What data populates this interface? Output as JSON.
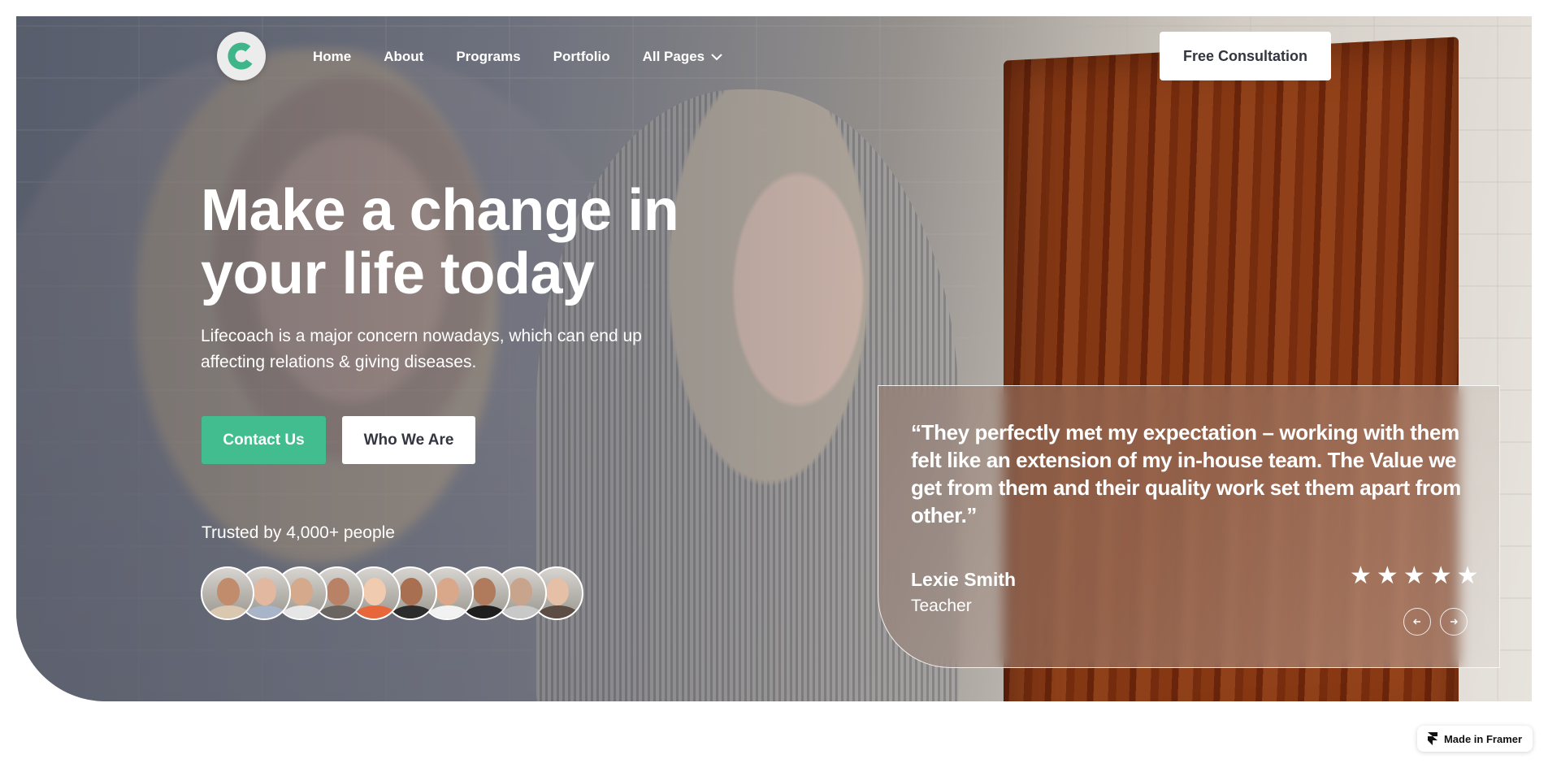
{
  "nav": {
    "logo_letter": "C",
    "items": [
      {
        "label": "Home"
      },
      {
        "label": "About"
      },
      {
        "label": "Programs"
      },
      {
        "label": "Portfolio"
      },
      {
        "label": "All Pages"
      }
    ],
    "cta_label": "Free Consultation"
  },
  "hero": {
    "headline_line1": "Make a change in",
    "headline_line2": "your life today",
    "subtext": "Lifecoach is a major concern nowadays, which can end up affecting relations & giving diseases.",
    "primary_button": "Contact Us",
    "secondary_button": "Who We Are",
    "trusted_text": "Trusted by 4,000+ people"
  },
  "avatars": [
    {
      "skin": "#c08c6c",
      "clothes": "#d9c7b0"
    },
    {
      "skin": "#e3b8a0",
      "clothes": "#a8b4c8"
    },
    {
      "skin": "#d4a98c",
      "clothes": "#e6e6e6"
    },
    {
      "skin": "#b98266",
      "clothes": "#6a6560"
    },
    {
      "skin": "#f0cbb0",
      "clothes": "#e8673a"
    },
    {
      "skin": "#a87050",
      "clothes": "#2c2c2c"
    },
    {
      "skin": "#d9a88a",
      "clothes": "#f2f2f2"
    },
    {
      "skin": "#b07a5c",
      "clothes": "#1e1e1e"
    },
    {
      "skin": "#c9a48c",
      "clothes": "#c8c8c8"
    },
    {
      "skin": "#e5c0a6",
      "clothes": "#5c4c44"
    }
  ],
  "testimonial": {
    "quote": "“They perfectly met my expectation – working with them felt like an extension of my in-house team. The Value we get from them and their quality work set them apart from other.”",
    "author": "Lexie Smith",
    "role": "Teacher",
    "rating": 5,
    "prev_icon": "arrow-left-icon",
    "next_icon": "arrow-right-icon"
  },
  "badge": {
    "label": "Made in Framer"
  },
  "colors": {
    "accent": "#41bd8f",
    "text_dark": "#333640"
  }
}
